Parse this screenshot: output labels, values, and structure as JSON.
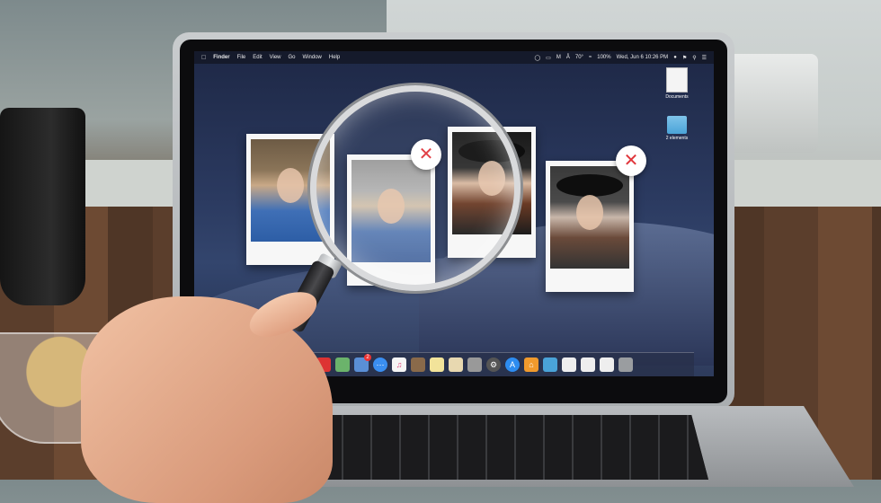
{
  "menubar": {
    "apple_icon": "apple-icon",
    "items": [
      "Finder",
      "File",
      "Edit",
      "View",
      "Go",
      "Window",
      "Help"
    ],
    "status": {
      "temperature": "70°",
      "battery": "100%",
      "clock": "Wed, Jun 6  10:26 PM"
    }
  },
  "desktop_icons": [
    {
      "label": "Documents",
      "icon": "document-icon"
    },
    {
      "label": "2 elements",
      "icon": "folder-icon"
    }
  ],
  "photos": [
    {
      "subject": "woman-lace-blue",
      "state": "original"
    },
    {
      "subject": "woman-lace-blue",
      "state": "duplicate",
      "reject_symbol": "✕"
    },
    {
      "subject": "woman-black-hat",
      "state": "original"
    },
    {
      "subject": "woman-black-hat",
      "state": "duplicate",
      "reject_symbol": "✕"
    }
  ],
  "dock": {
    "badge": "2",
    "icons": [
      "finder-icon",
      "photos-icon",
      "mail-icon",
      "messages-icon",
      "music-icon",
      "books-icon",
      "notes-icon",
      "preview-icon",
      "image-capture-icon",
      "system-preferences-icon",
      "app-store-icon",
      "home-icon",
      "folder-icon",
      "document-icon",
      "document-icon",
      "document-icon",
      "trash-icon"
    ]
  },
  "colors": {
    "reject": "#e0353b",
    "screen_top": "#1e2846",
    "folder": "#4aa3d8"
  }
}
